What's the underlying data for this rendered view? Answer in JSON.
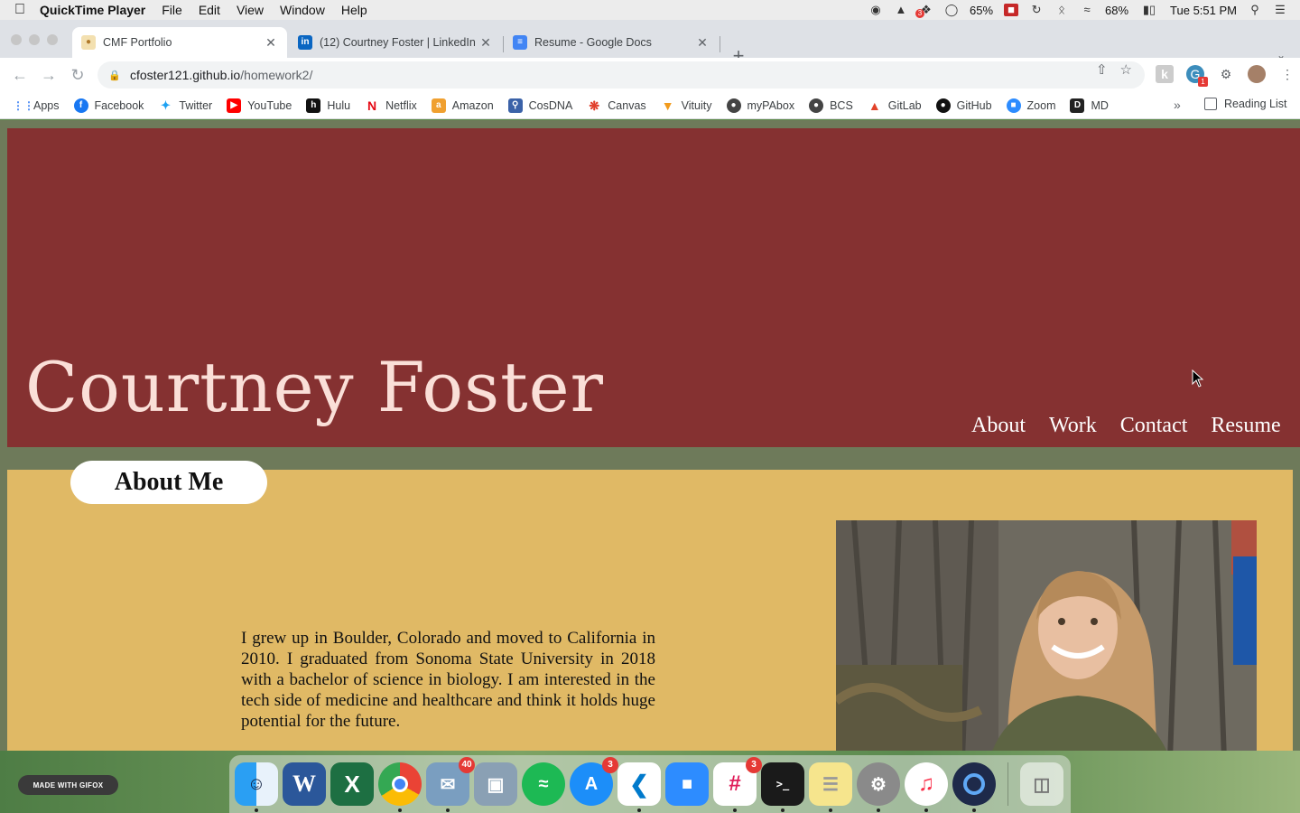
{
  "menubar": {
    "app_name": "QuickTime Player",
    "menus": [
      "File",
      "Edit",
      "View",
      "Window",
      "Help"
    ],
    "badge_count": "3",
    "battery_pct_1": "65%",
    "battery_pct_2": "68%",
    "clock": "Tue 5:51 PM"
  },
  "tabs": [
    {
      "label": "CMF Portfolio",
      "active": true
    },
    {
      "label": "(12) Courtney Foster | LinkedIn",
      "active": false
    },
    {
      "label": "Resume - Google Docs",
      "active": false
    }
  ],
  "toolbar": {
    "url_host": "cfoster121.github.io",
    "url_path": "/homework2/",
    "extension_badge": "1"
  },
  "bookmarks": {
    "items": [
      "Apps",
      "Facebook",
      "Twitter",
      "YouTube",
      "Hulu",
      "Netflix",
      "Amazon",
      "CosDNA",
      "Canvas",
      "Vituity",
      "myPAbox",
      "BCS",
      "GitLab",
      "GitHub",
      "Zoom",
      "MD"
    ],
    "more": "»",
    "reading_list": "Reading List"
  },
  "page": {
    "name": "Courtney Foster",
    "nav": [
      "About",
      "Work",
      "Contact",
      "Resume"
    ],
    "about_heading": "About Me",
    "about_text": "I grew up in Boulder, Colorado and moved to California in 2010. I graduated from Sonoma State University in 2018 with a bachelor of science in biology. I am interested in the tech side of medicine and healthcare and think it holds huge potential for the future."
  },
  "colors": {
    "hero": "#853131",
    "about": "#e0b965",
    "name_text": "#fadfd8"
  },
  "gifox_label": "MADE WITH GIFOX",
  "dock": {
    "mail_badge": "40",
    "appstore_badge": "3",
    "slack_badge": "3"
  }
}
